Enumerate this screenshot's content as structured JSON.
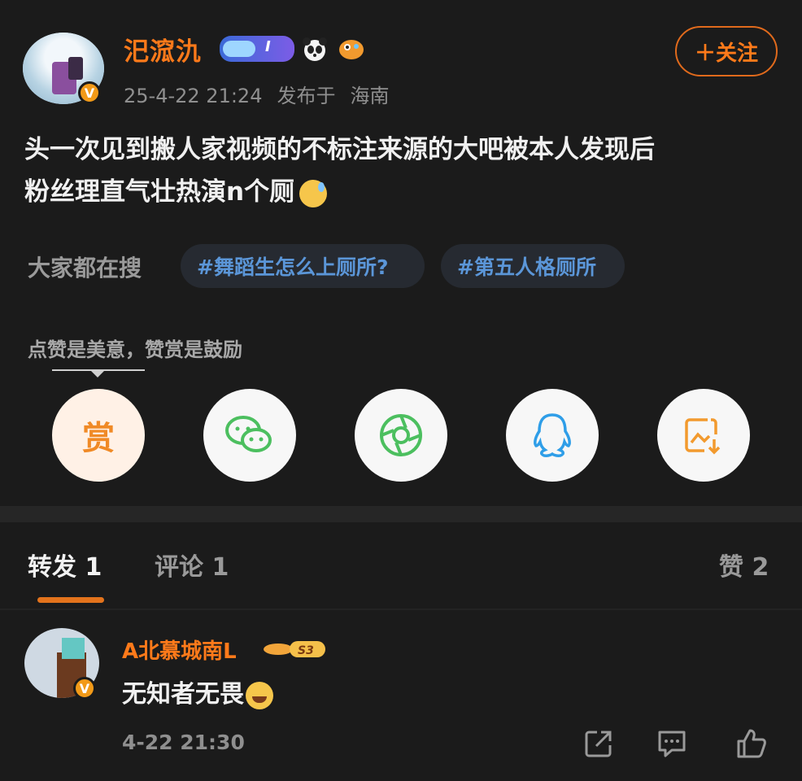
{
  "post": {
    "username": "汜溛氿",
    "badge_level": "I",
    "date": "25-4-22 21:24",
    "published_from": "发布于",
    "location": "海南",
    "follow_label": "＋关注",
    "text_line1": "头一次见到搬人家视频的不标注来源的大吧被本人发现后",
    "text_line2": "粉丝理直气壮热演n个厕"
  },
  "search": {
    "label": "大家都在搜",
    "tags": [
      "#舞蹈生怎么上厕所?",
      "#第五人格厕所"
    ]
  },
  "reward": {
    "caption": "点赞是美意，赞赏是鼓励",
    "reward_label": "赏"
  },
  "share_icons": [
    "reward-icon",
    "wechat-icon",
    "moments-icon",
    "qq-icon",
    "save-image-icon"
  ],
  "tabs": {
    "repost": "转发 1",
    "comment": "评论 1",
    "like": "赞 2"
  },
  "comment": {
    "username": "A北慕城南L",
    "badge": "S3",
    "text": "无知者无畏",
    "time": "4-22 21:30"
  },
  "colors": {
    "accent": "#ff7a1a",
    "tag_text": "#5b96d8",
    "background": "#1b1b1b"
  }
}
